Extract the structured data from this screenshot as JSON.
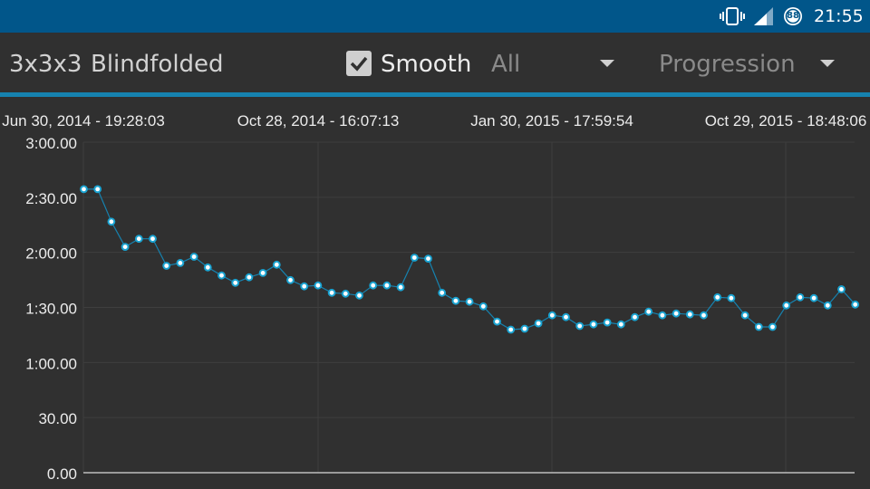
{
  "status_bar": {
    "time": "21:55",
    "battery_level": "88",
    "icons": [
      "vibrate-icon",
      "signal-icon",
      "battery-icon"
    ]
  },
  "toolbar": {
    "puzzle": "3x3x3",
    "category": "Blindfolded",
    "smooth_label": "Smooth",
    "smooth_checked": true,
    "range_value": "All",
    "mode_value": "Progression"
  },
  "colors": {
    "status_bar": "#01568A",
    "background": "#303030",
    "accent": "#1682AF",
    "point_fill": "#ffffff",
    "point_stroke": "#1aa3d1"
  },
  "chart_data": {
    "type": "line",
    "x_tick_labels": [
      "Jun 30, 2014 - 19:28:03",
      "Oct 28, 2014 - 16:07:13",
      "Jan 30, 2015 - 17:59:54",
      "Oct 29, 2015 - 18:48:06"
    ],
    "y_tick_labels": [
      "3:00.00",
      "2:30.00",
      "2:00.00",
      "1:30.00",
      "1:00.00",
      "30.00",
      "0.00"
    ],
    "ylim_seconds": [
      0,
      180
    ],
    "y_tick_values_seconds": [
      180,
      150,
      120,
      90,
      60,
      30,
      0
    ],
    "grid": true,
    "series": [
      {
        "values_seconds": [
          154.4,
          154.4,
          136.7,
          123.0,
          127.4,
          127.4,
          112.7,
          114.2,
          117.6,
          111.8,
          107.4,
          103.4,
          106.4,
          108.8,
          113.3,
          104.9,
          101.5,
          102.0,
          98.0,
          97.5,
          96.5,
          102.0,
          102.0,
          101.0,
          117.1,
          116.6,
          98.0,
          93.6,
          93.1,
          90.6,
          82.3,
          77.9,
          78.4,
          81.3,
          85.7,
          84.7,
          79.9,
          80.8,
          81.8,
          80.8,
          84.7,
          87.7,
          85.7,
          86.7,
          86.2,
          85.7,
          95.5,
          95.1,
          85.7,
          79.4,
          79.4,
          91.1,
          95.5,
          95.1,
          91.1,
          99.9,
          91.6
        ]
      }
    ]
  }
}
